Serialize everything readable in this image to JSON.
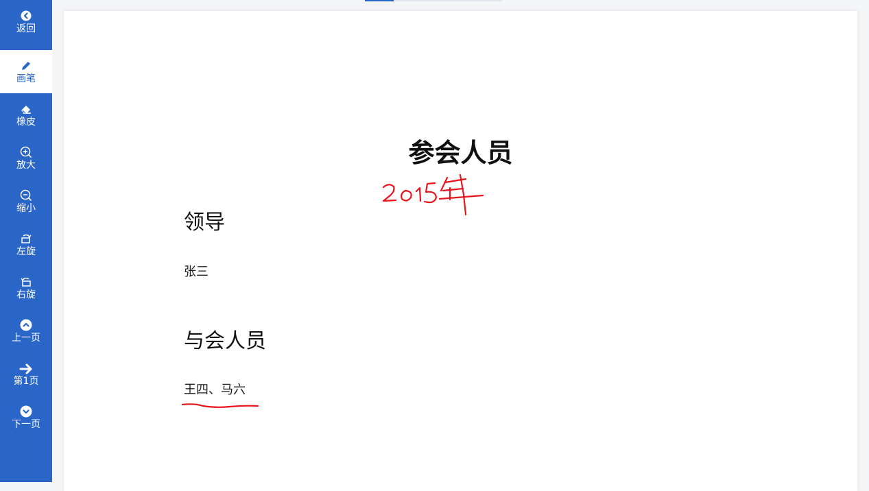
{
  "sidebar": {
    "tools": [
      {
        "label": "返回",
        "icon": "back-circle-icon"
      },
      {
        "label": "画笔",
        "icon": "pencil-icon"
      },
      {
        "label": "橡皮",
        "icon": "eraser-icon"
      },
      {
        "label": "放大",
        "icon": "zoom-in-icon"
      },
      {
        "label": "缩小",
        "icon": "zoom-out-icon"
      },
      {
        "label": "左旋",
        "icon": "rotate-left-icon"
      },
      {
        "label": "右旋",
        "icon": "rotate-right-icon"
      },
      {
        "label": "上一页",
        "icon": "chevron-up-circle-icon"
      },
      {
        "label": "第1页",
        "icon": "arrow-right-icon"
      },
      {
        "label": "下一页",
        "icon": "chevron-down-circle-icon"
      }
    ],
    "active_tool": "画笔"
  },
  "document": {
    "title": "参会人员",
    "section1_heading": "领导",
    "section1_text": "张三",
    "section2_heading": "与会人员",
    "section2_text": "王四、马六"
  },
  "annotations": {
    "handwritten_text": "2015年",
    "ink_color": "#e8141c"
  },
  "colors": {
    "sidebar": "#2a66c7",
    "active_tool_bg": "#ffffff",
    "page_bg": "#ffffff",
    "canvas_bg": "#f4f5f7"
  }
}
